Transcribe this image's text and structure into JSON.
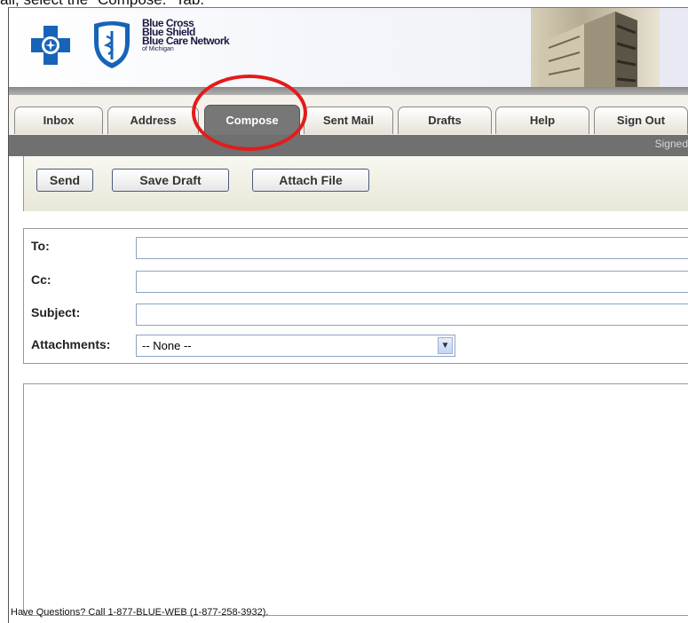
{
  "instruction": "ail, select the \"Compose.\" Tab.",
  "brand": {
    "line1": "Blue Cross",
    "line2": "Blue Shield",
    "line3": "Blue Care Network",
    "line4": "of Michigan"
  },
  "tabs": [
    {
      "label": "Inbox"
    },
    {
      "label": "Address"
    },
    {
      "label": "Compose"
    },
    {
      "label": "Sent Mail"
    },
    {
      "label": "Drafts"
    },
    {
      "label": "Help"
    },
    {
      "label": "Sign Out"
    }
  ],
  "active_tab": "Compose",
  "status": "Signed",
  "toolbar": {
    "send_label": "Send",
    "save_draft_label": "Save Draft",
    "attach_file_label": "Attach File"
  },
  "form": {
    "to_label": "To:",
    "to_value": "",
    "cc_label": "Cc:",
    "cc_value": "",
    "subject_label": "Subject:",
    "subject_value": "",
    "attachments_label": "Attachments:",
    "attachments_value": "-- None --"
  },
  "message_body": "",
  "footer": "Have Questions? Call 1-877-BLUE-WEB (1-877-258-3932).",
  "colors": {
    "highlight": "#e41b1b",
    "active_tab": "#777777",
    "tab_strip": "#707070",
    "field_border": "#8ea3c4"
  }
}
